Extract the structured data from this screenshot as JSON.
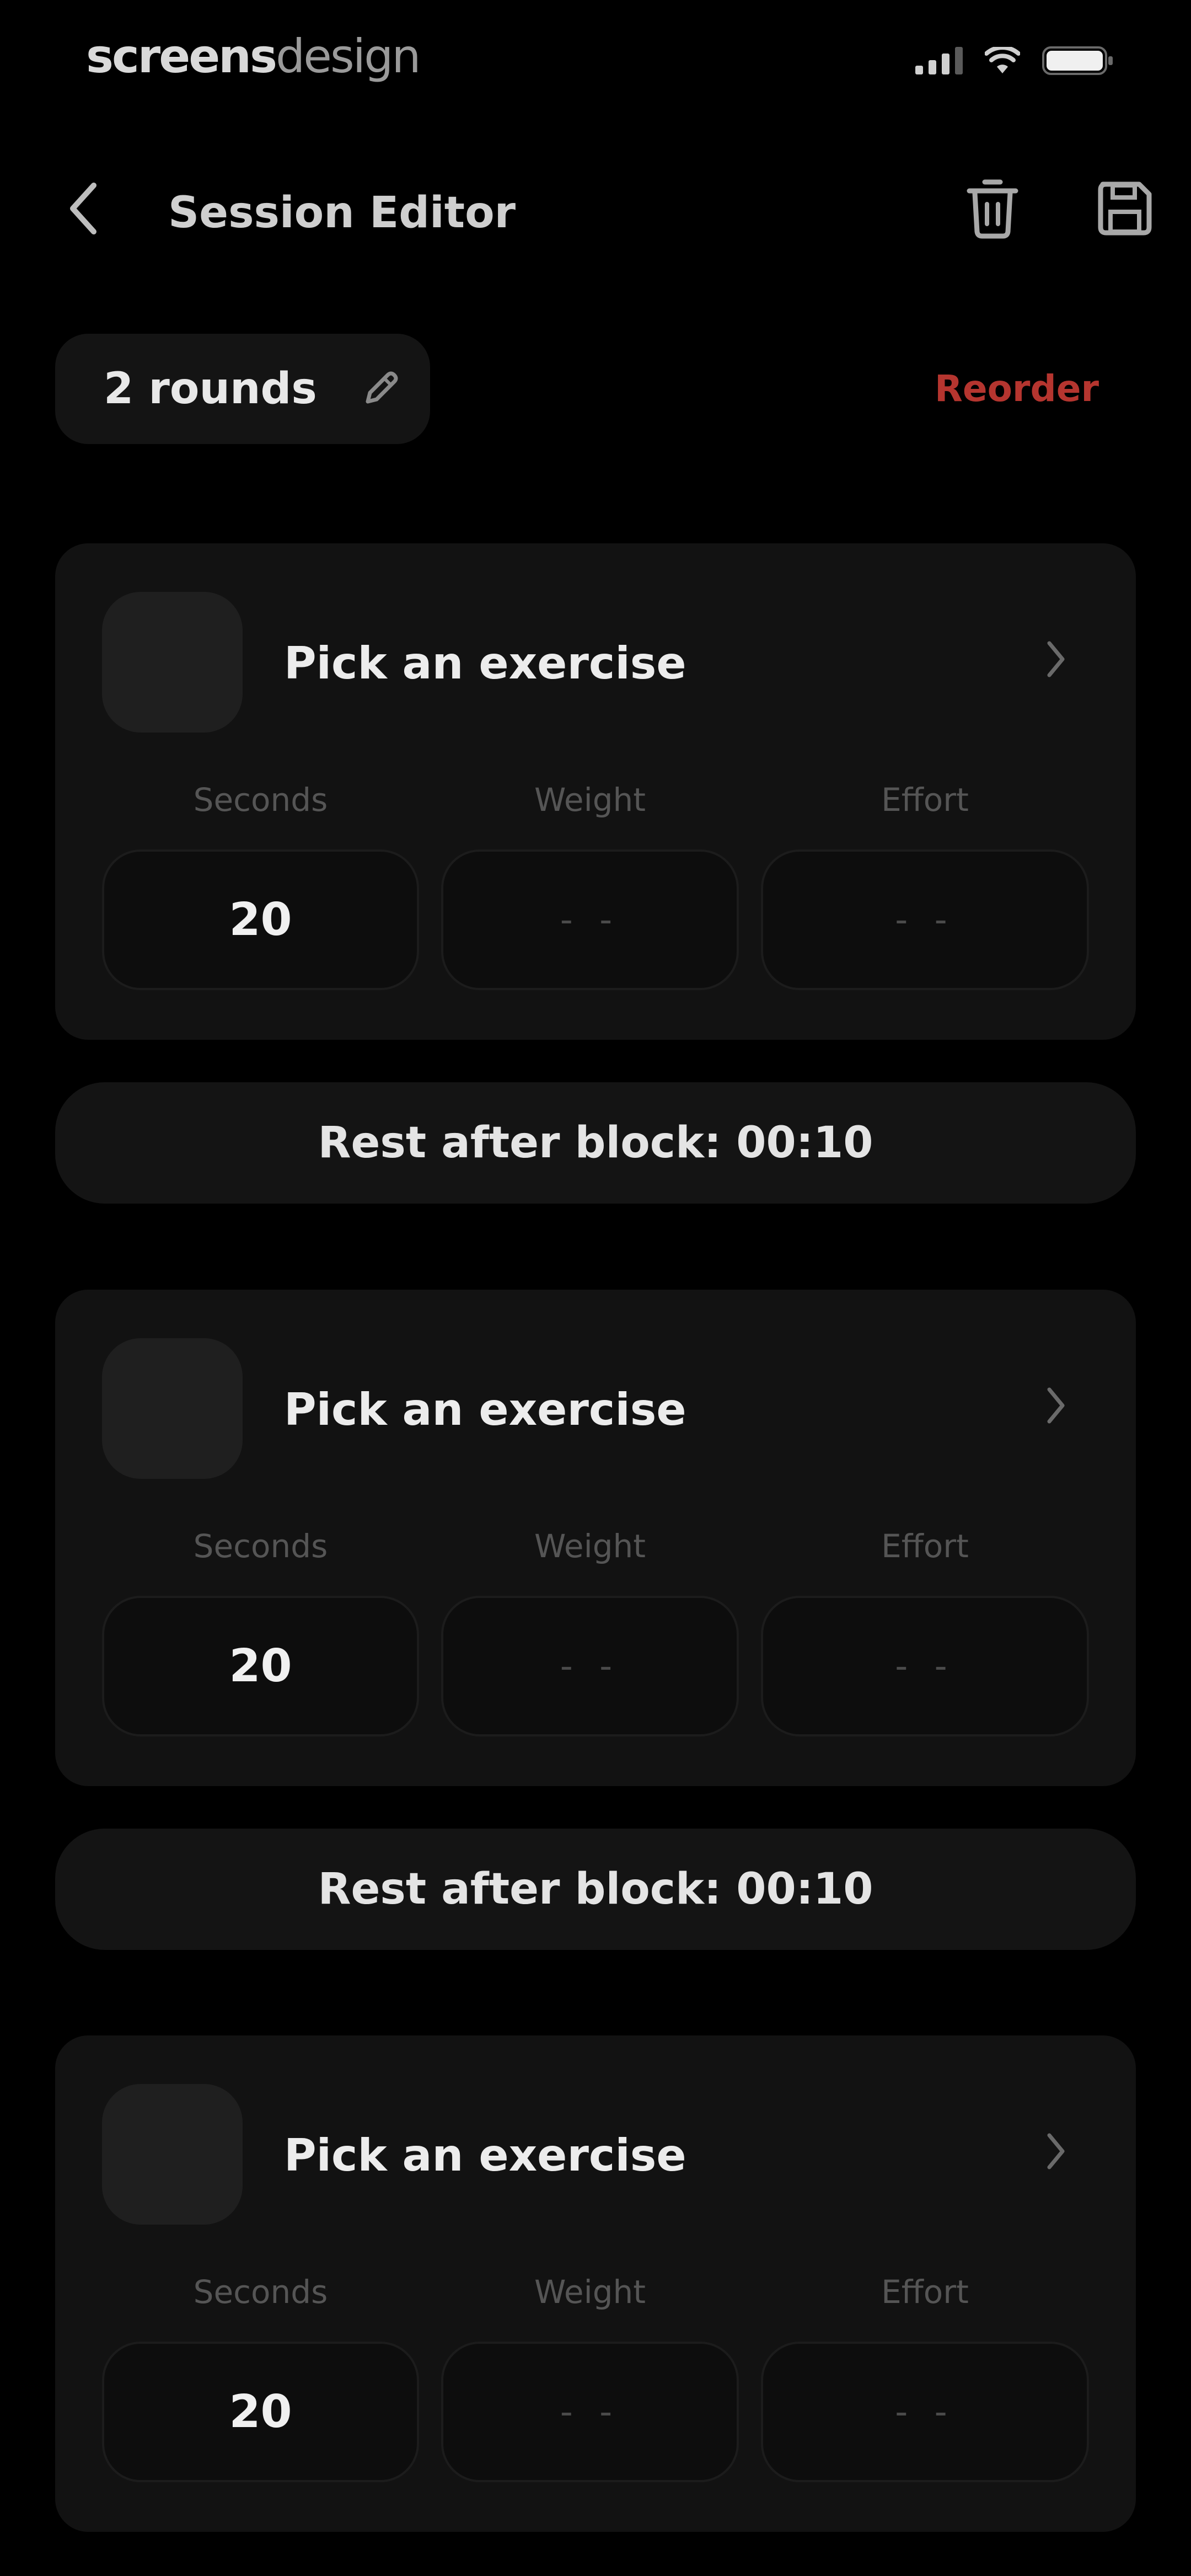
{
  "status_bar": {
    "logo_bold": "screens",
    "logo_light": "design"
  },
  "header": {
    "title": "Session Editor",
    "icons": [
      "chevron-left-icon",
      "trash-icon",
      "save-icon"
    ]
  },
  "rounds": {
    "label": "2 rounds",
    "reorder_label": "Reorder"
  },
  "colors": {
    "background": "#000000",
    "card": "#121212",
    "accent": "#b5352f"
  },
  "blocks": [
    {
      "exercise_label": "Pick an exercise",
      "fields": [
        {
          "label": "Seconds",
          "value": "20"
        },
        {
          "label": "Weight",
          "value": "- -"
        },
        {
          "label": "Effort",
          "value": "- -"
        }
      ],
      "rest_label": "Rest after block: 00:10"
    },
    {
      "exercise_label": "Pick an exercise",
      "fields": [
        {
          "label": "Seconds",
          "value": "20"
        },
        {
          "label": "Weight",
          "value": "- -"
        },
        {
          "label": "Effort",
          "value": "- -"
        }
      ],
      "rest_label": "Rest after block: 00:10"
    },
    {
      "exercise_label": "Pick an exercise",
      "fields": [
        {
          "label": "Seconds",
          "value": "20"
        },
        {
          "label": "Weight",
          "value": "- -"
        },
        {
          "label": "Effort",
          "value": "- -"
        }
      ]
    }
  ]
}
